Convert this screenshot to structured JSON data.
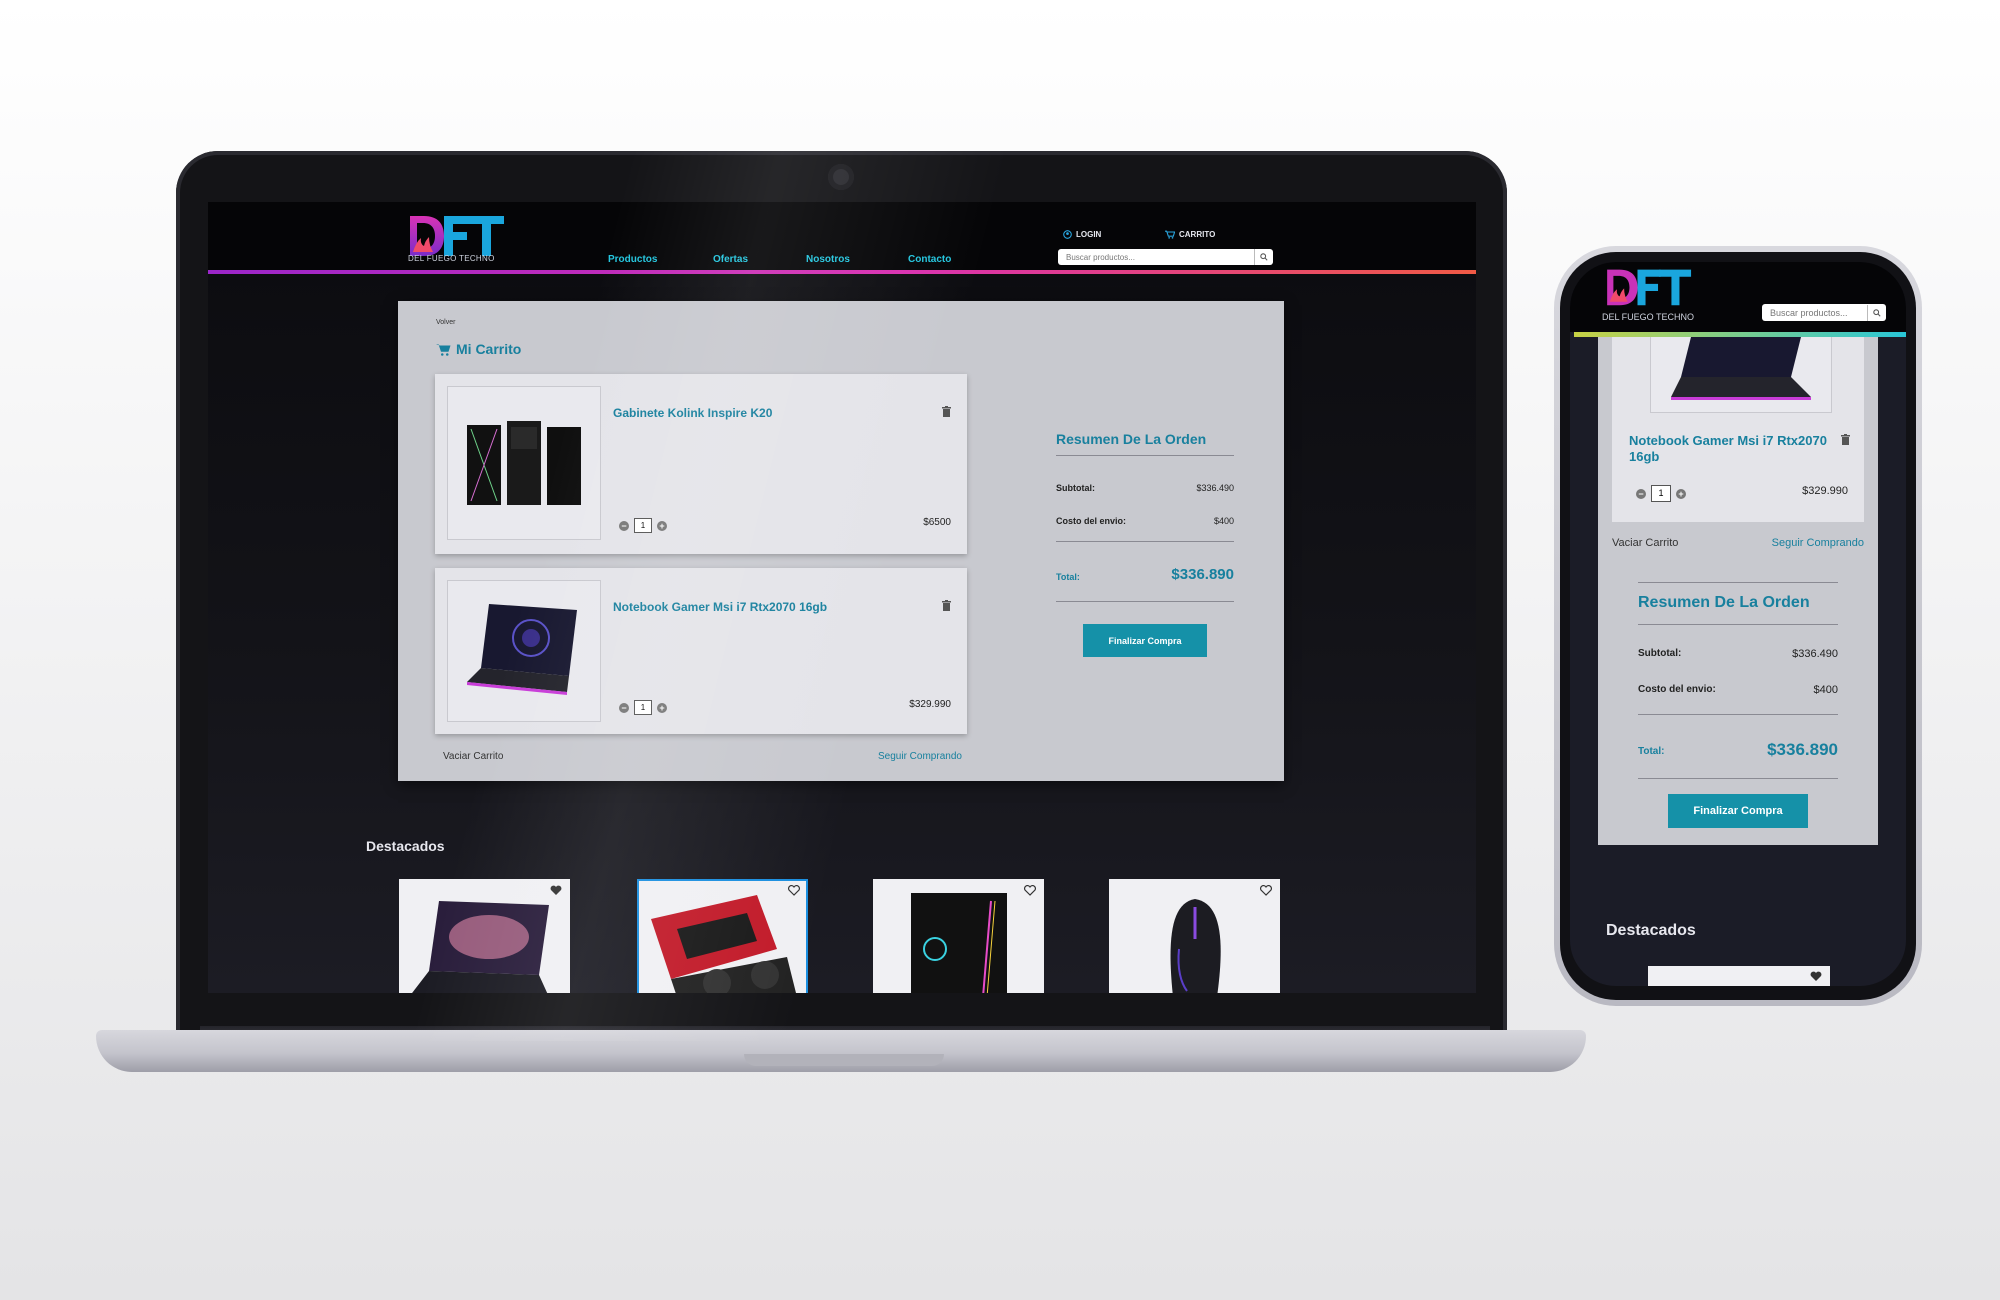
{
  "brand": {
    "logo_text": "DFT",
    "tagline": "DEL FUEGO TECHNO"
  },
  "nav": {
    "items": [
      "Productos",
      "Ofertas",
      "Nosotros",
      "Contacto"
    ]
  },
  "header": {
    "login": "LOGIN",
    "cart": "CARRITO",
    "search_placeholder": "Buscar productos..."
  },
  "cart": {
    "back": "Volver",
    "title": "Mi Carrito",
    "items": [
      {
        "name": "Gabinete Kolink Inspire K20",
        "qty": "1",
        "price": "$6500"
      },
      {
        "name": "Notebook Gamer Msi i7 Rtx2070 16gb",
        "qty": "1",
        "price": "$329.990"
      }
    ],
    "empty_label": "Vaciar Carrito",
    "continue_label": "Seguir Comprando"
  },
  "summary": {
    "title": "Resumen De La Orden",
    "subtotal_label": "Subtotal:",
    "subtotal": "$336.490",
    "shipping_label": "Costo del envio:",
    "shipping": "$400",
    "total_label": "Total:",
    "total": "$336.890",
    "checkout": "Finalizar Compra"
  },
  "featured": {
    "title": "Destacados"
  },
  "colors": {
    "accent": "#18809e",
    "button": "#1591a8",
    "nav": "#24c7e0"
  }
}
